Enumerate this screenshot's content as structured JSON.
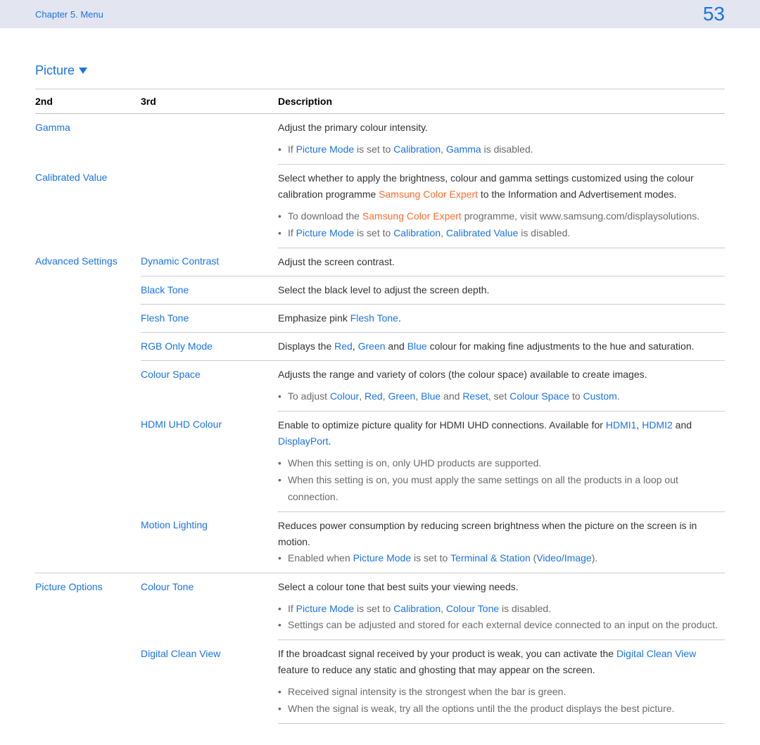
{
  "header": {
    "chapter": "Chapter 5. Menu",
    "page_no": "53"
  },
  "section": {
    "title": "Picture"
  },
  "table": {
    "headers": {
      "c1": "2nd",
      "c2": "3rd",
      "c3": "Description"
    }
  },
  "rows": {
    "gamma": {
      "name": "Gamma",
      "desc": "Adjust the primary colour intensity.",
      "b1_pre": "If ",
      "b1_pm": "Picture Mode",
      "b1_mid": " is set to ",
      "b1_cal": "Calibration",
      "b1_c": ", ",
      "b1_g": "Gamma",
      "b1_end": " is disabled."
    },
    "calibrated": {
      "name": "Calibrated Value",
      "desc1": "Select whether to apply the brightness, colour and gamma settings customized using the colour calibration programme ",
      "sce": "Samsung Color Expert",
      "desc2": " to the Information and Advertisement modes.",
      "b1_pre": "To download the ",
      "b1_sce": "Samsung Color Expert",
      "b1_end": " programme, visit www.samsung.com/displaysolutions.",
      "b2_pre": "If ",
      "b2_pm": "Picture Mode",
      "b2_mid": " is set to ",
      "b2_cal": "Calibration",
      "b2_c": ", ",
      "b2_cv": "Calibrated Value",
      "b2_end": " is disabled."
    },
    "adv": {
      "name": "Advanced Settings",
      "dyn": {
        "name": "Dynamic Contrast",
        "desc": "Adjust the screen contrast."
      },
      "black": {
        "name": "Black Tone",
        "desc": "Select the black level to adjust the screen depth."
      },
      "flesh": {
        "name": "Flesh Tone",
        "d1": "Emphasize pink ",
        "ft": "Flesh Tone",
        "d2": "."
      },
      "rgb": {
        "name": "RGB Only Mode",
        "d1": "Displays the ",
        "red": "Red",
        "c1": ", ",
        "green": "Green",
        "c2": " and ",
        "blue": "Blue",
        "d2": " colour for making fine adjustments to the hue and saturation."
      },
      "colourspace": {
        "name": "Colour Space",
        "desc": "Adjusts the range and variety of colors (the colour space) available to create images.",
        "b1_pre": "To adjust ",
        "col": "Colour",
        "c1": ", ",
        "red": "Red",
        "c2": ", ",
        "green": "Green",
        "c3": ", ",
        "blue": "Blue",
        "c4": " and ",
        "reset": "Reset",
        "mid": ", set ",
        "cs": "Colour Space",
        "to": " to ",
        "custom": "Custom",
        "end": "."
      },
      "hdmi": {
        "name": "HDMI UHD Colour",
        "d1": "Enable to optimize picture quality for HDMI UHD connections. Available for ",
        "h1": "HDMI1",
        "c1": ", ",
        "h2": "HDMI2",
        "c2": " and ",
        "dp": "DisplayPort",
        "d2": ".",
        "b1": "When this setting is on, only UHD products are supported.",
        "b2": "When this setting is on, you must apply the same settings on all the products in a loop out connection."
      },
      "motion": {
        "name": "Motion Lighting",
        "desc": "Reduces power consumption by reducing screen brightness when the picture on the screen is in motion.",
        "b1_pre": "Enabled when ",
        "pm": "Picture Mode",
        "mid": " is set to ",
        "ts": "Terminal & Station",
        "sp": " (",
        "vi": "Video/Image",
        "end": ")."
      }
    },
    "picopt": {
      "name": "Picture Options",
      "ctone": {
        "name": "Colour Tone",
        "desc": "Select a colour tone that best suits your viewing needs.",
        "b1_pre": "If ",
        "pm": "Picture Mode",
        "mid": " is set to ",
        "cal": "Calibration",
        "c": ", ",
        "ct": "Colour Tone",
        "end": " is disabled.",
        "b2": "Settings can be adjusted and stored for each external device connected to an input on the product."
      },
      "dcv": {
        "name": "Digital Clean View",
        "d1": "If the broadcast signal received by your product is weak, you can activate the ",
        "dcv": "Digital Clean View",
        "d2": " feature to reduce any static and ghosting that may appear on the screen.",
        "b1": "Received signal intensity is the strongest when the bar is green.",
        "b2": "When the signal is weak, try all the options until the the product displays the best picture."
      }
    }
  }
}
